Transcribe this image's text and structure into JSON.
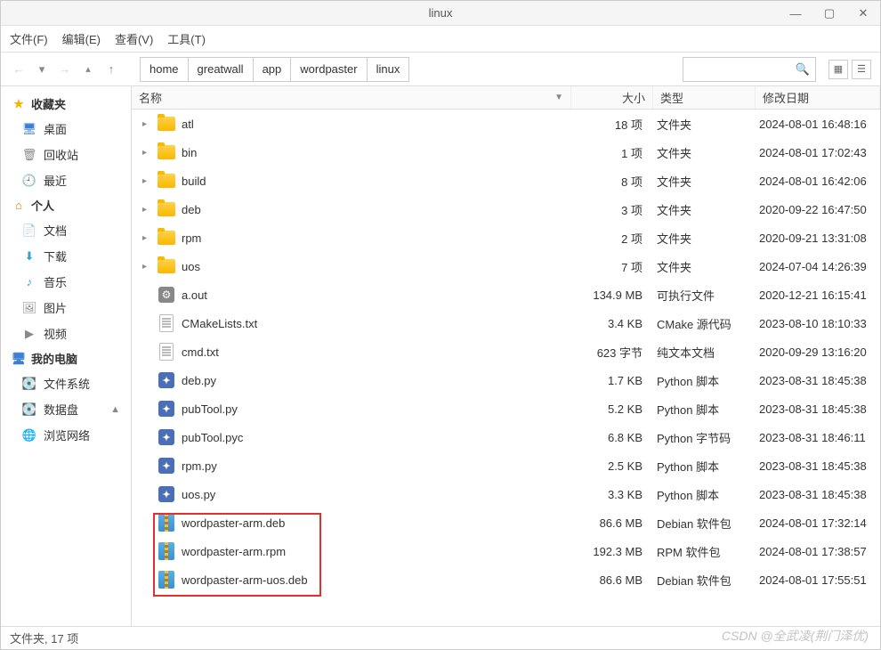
{
  "window": {
    "title": "linux"
  },
  "menu": {
    "file": "文件(F)",
    "edit": "编辑(E)",
    "view": "查看(V)",
    "tools": "工具(T)"
  },
  "breadcrumbs": [
    "home",
    "greatwall",
    "app",
    "wordpaster",
    "linux"
  ],
  "search": {
    "placeholder": ""
  },
  "columns": {
    "name": "名称",
    "size": "大小",
    "type": "类型",
    "date": "修改日期"
  },
  "sidebar": {
    "favorites": {
      "title": "收藏夹",
      "items": [
        {
          "icon": "🖥",
          "color": "#3a7fd1",
          "label": "桌面"
        },
        {
          "icon": "🗑",
          "color": "#888",
          "label": "回收站"
        },
        {
          "icon": "🕘",
          "color": "#d19a3a",
          "label": "最近"
        }
      ]
    },
    "personal": {
      "title": "个人",
      "items": [
        {
          "icon": "📄",
          "color": "#6a8fce",
          "label": "文档"
        },
        {
          "icon": "⬇",
          "color": "#3a9fd1",
          "label": "下载"
        },
        {
          "icon": "♪",
          "color": "#3a9fd1",
          "label": "音乐"
        },
        {
          "icon": "🖼",
          "color": "#888",
          "label": "图片"
        },
        {
          "icon": "▶",
          "color": "#888",
          "label": "视频"
        }
      ]
    },
    "computer": {
      "title": "我的电脑",
      "items": [
        {
          "icon": "💽",
          "color": "#3a9fd1",
          "label": "文件系统",
          "eject": false
        },
        {
          "icon": "💽",
          "color": "#3a9fd1",
          "label": "数据盘",
          "eject": true
        },
        {
          "icon": "🌐",
          "color": "#3a9fd1",
          "label": "浏览网络",
          "eject": false
        }
      ]
    }
  },
  "files": [
    {
      "expandable": true,
      "icon": "folder",
      "name": "atl",
      "size": "18 项",
      "type": "文件夹",
      "date": "2024-08-01 16:48:16"
    },
    {
      "expandable": true,
      "icon": "folder",
      "name": "bin",
      "size": "1 项",
      "type": "文件夹",
      "date": "2024-08-01 17:02:43"
    },
    {
      "expandable": true,
      "icon": "folder",
      "name": "build",
      "size": "8 项",
      "type": "文件夹",
      "date": "2024-08-01 16:42:06"
    },
    {
      "expandable": true,
      "icon": "folder",
      "name": "deb",
      "size": "3 项",
      "type": "文件夹",
      "date": "2020-09-22 16:47:50"
    },
    {
      "expandable": true,
      "icon": "folder",
      "name": "rpm",
      "size": "2 项",
      "type": "文件夹",
      "date": "2020-09-21 13:31:08"
    },
    {
      "expandable": true,
      "icon": "folder",
      "name": "uos",
      "size": "7 项",
      "type": "文件夹",
      "date": "2024-07-04 14:26:39"
    },
    {
      "expandable": false,
      "icon": "exec",
      "name": "a.out",
      "size": "134.9 MB",
      "type": "可执行文件",
      "date": "2020-12-21 16:15:41"
    },
    {
      "expandable": false,
      "icon": "text",
      "name": "CMakeLists.txt",
      "size": "3.4 KB",
      "type": "CMake 源代码",
      "date": "2023-08-10 18:10:33"
    },
    {
      "expandable": false,
      "icon": "text",
      "name": "cmd.txt",
      "size": "623 字节",
      "type": "纯文本文档",
      "date": "2020-09-29 13:16:20"
    },
    {
      "expandable": false,
      "icon": "python",
      "name": "deb.py",
      "size": "1.7 KB",
      "type": "Python 脚本",
      "date": "2023-08-31 18:45:38"
    },
    {
      "expandable": false,
      "icon": "python",
      "name": "pubTool.py",
      "size": "5.2 KB",
      "type": "Python 脚本",
      "date": "2023-08-31 18:45:38"
    },
    {
      "expandable": false,
      "icon": "python",
      "name": "pubTool.pyc",
      "size": "6.8 KB",
      "type": "Python 字节码",
      "date": "2023-08-31 18:46:11"
    },
    {
      "expandable": false,
      "icon": "python",
      "name": "rpm.py",
      "size": "2.5 KB",
      "type": "Python 脚本",
      "date": "2023-08-31 18:45:38"
    },
    {
      "expandable": false,
      "icon": "python",
      "name": "uos.py",
      "size": "3.3 KB",
      "type": "Python 脚本",
      "date": "2023-08-31 18:45:38"
    },
    {
      "expandable": false,
      "icon": "archive",
      "name": "wordpaster-arm.deb",
      "size": "86.6 MB",
      "type": "Debian 软件包",
      "date": "2024-08-01 17:32:14"
    },
    {
      "expandable": false,
      "icon": "archive",
      "name": "wordpaster-arm.rpm",
      "size": "192.3 MB",
      "type": "RPM 软件包",
      "date": "2024-08-01 17:38:57"
    },
    {
      "expandable": false,
      "icon": "archive",
      "name": "wordpaster-arm-uos.deb",
      "size": "86.6 MB",
      "type": "Debian 软件包",
      "date": "2024-08-01 17:55:51"
    }
  ],
  "status": "文件夹, 17 项",
  "watermark": "CSDN @全武凌(荆门泽优)"
}
